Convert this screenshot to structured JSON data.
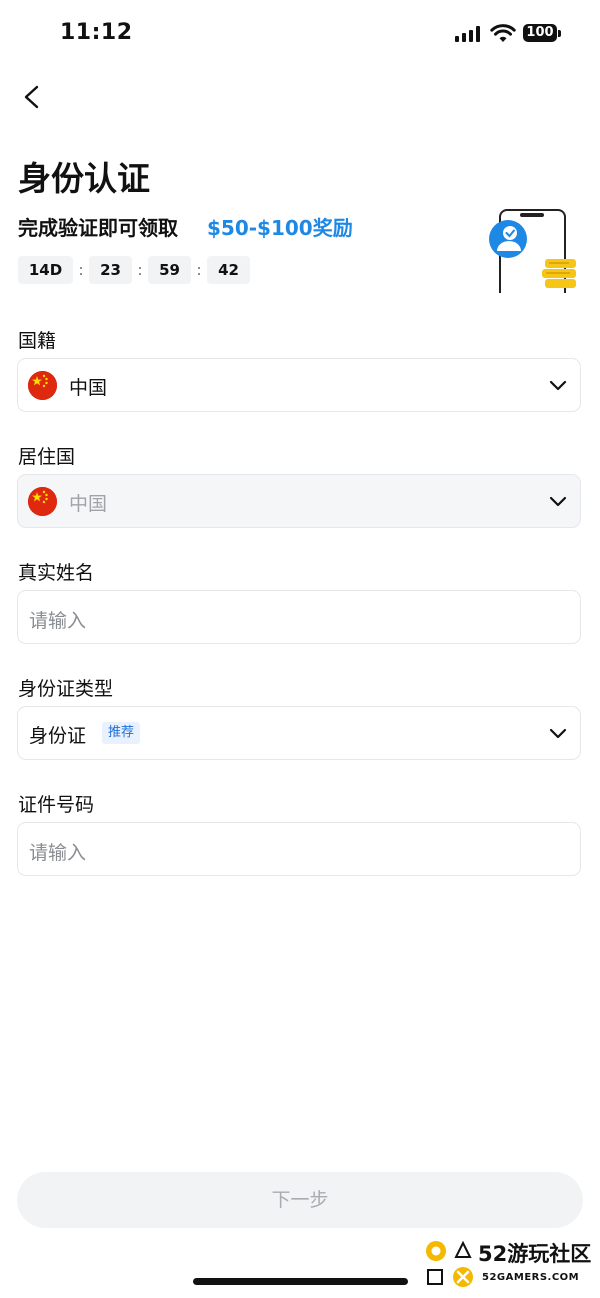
{
  "status_bar": {
    "time": "11:12",
    "battery": "100"
  },
  "header": {
    "title": "身份认证",
    "subtitle": "完成验证即可领取",
    "reward": "$50-$100奖励"
  },
  "countdown": {
    "days": "14D",
    "hours": "23",
    "minutes": "59",
    "seconds": "42",
    "separator": ":"
  },
  "form": {
    "nationality": {
      "label": "国籍",
      "value": "中国"
    },
    "residence": {
      "label": "居住国",
      "value": "中国"
    },
    "real_name": {
      "label": "真实姓名",
      "placeholder": "请输入"
    },
    "id_type": {
      "label": "身份证类型",
      "value": "身份证",
      "badge": "推荐"
    },
    "id_number": {
      "label": "证件号码",
      "placeholder": "请输入"
    }
  },
  "next_button": {
    "label": "下一步"
  },
  "watermark": {
    "cn": "52游玩社区",
    "en": "52GAMERS.COM"
  },
  "colors": {
    "accent": "#1e88e5",
    "flag_red": "#de2910",
    "flag_star": "#ffde00",
    "coin": "#f5c518"
  }
}
